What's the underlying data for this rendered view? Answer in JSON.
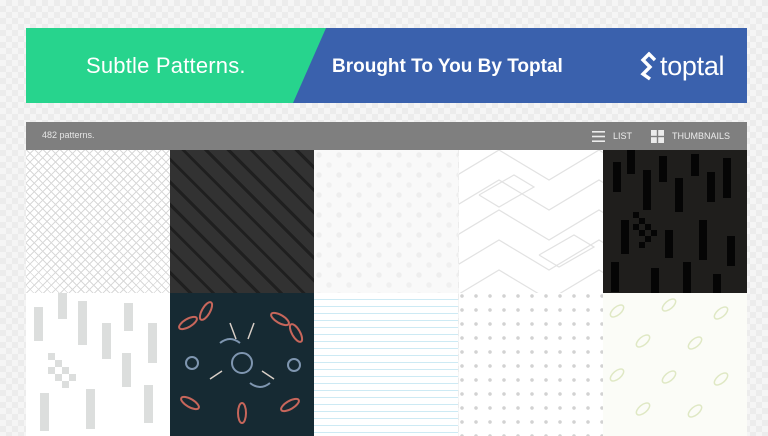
{
  "banner": {
    "title": "Subtle Patterns.",
    "tagline": "Brought To You By Toptal",
    "logo_text": "toptal",
    "logo_icon": "toptal-logo-icon",
    "colors": {
      "green": "#27d48d",
      "blue": "#3a61ad"
    }
  },
  "toolbar": {
    "count": "482 patterns.",
    "list_label": "LIST",
    "list_icon": "list-icon",
    "thumbnails_label": "THUMBNAILS",
    "thumbnails_icon": "grid-icon",
    "background": "#7f7f7f"
  },
  "patterns": [
    {
      "icon": "diamond-lattice-light"
    },
    {
      "icon": "diamond-quilt-dark"
    },
    {
      "icon": "dotted-white"
    },
    {
      "icon": "zigzag-maze-outline"
    },
    {
      "icon": "black-blocks-bars"
    },
    {
      "icon": "gray-blocks-bars"
    },
    {
      "icon": "floral-leaves-navy"
    },
    {
      "icon": "blue-waves"
    },
    {
      "icon": "gray-dots"
    },
    {
      "icon": "green-leaves"
    }
  ]
}
